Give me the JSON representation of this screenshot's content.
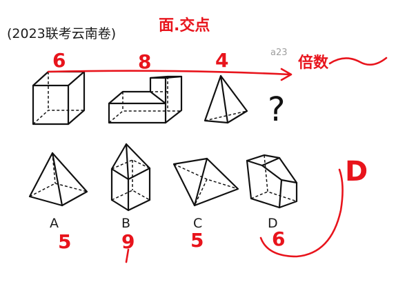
{
  "question": {
    "source": "(2023联考云南卷)",
    "missing_mark": "?"
  },
  "figures": [
    {
      "id": "fig-1",
      "shape": "cube"
    },
    {
      "id": "fig-2",
      "shape": "l-shaped-prism"
    },
    {
      "id": "fig-3",
      "shape": "triangular-pyramid"
    }
  ],
  "options": [
    {
      "letter": "A",
      "shape": "square-pyramid"
    },
    {
      "letter": "B",
      "shape": "cube-with-pyramid-roof"
    },
    {
      "letter": "C",
      "shape": "triangular-prism"
    },
    {
      "letter": "D",
      "shape": "truncated-prism"
    }
  ],
  "annotations": {
    "header_note": "面.交点",
    "figure_counts": [
      "6",
      "8",
      "4"
    ],
    "rule_note": "倍数",
    "option_counts": [
      "5",
      "9",
      "5",
      "6"
    ],
    "answer": "D",
    "color": "#e8141c"
  },
  "watermark": {
    "text": "a23"
  }
}
